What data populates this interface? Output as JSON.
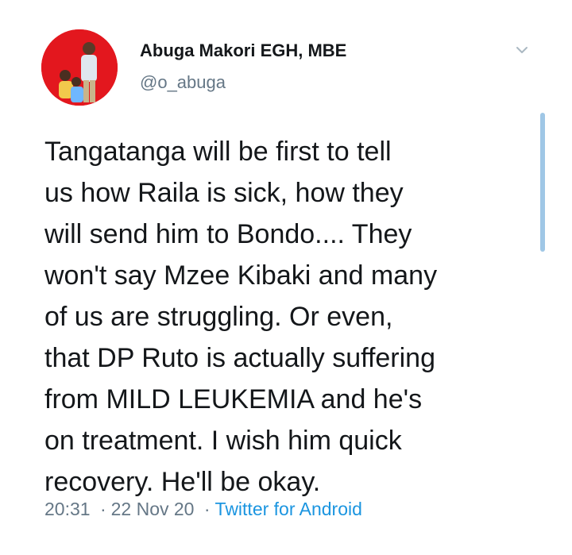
{
  "tweet": {
    "author": {
      "display_name": "Abuga Makori EGH, MBE",
      "handle": "@o_abuga"
    },
    "text": "Tangatanga will be first to tell\nus how Raila is sick, how they\nwill send him to Bondo.... They\nwon't say Mzee Kibaki and many\nof us are struggling. Or even,\nthat DP Ruto is actually suffering\nfrom MILD LEUKEMIA and he's\non treatment. I wish him quick\nrecovery. He'll be okay.",
    "time": "20:31",
    "separator": "·",
    "date": "22 Nov 20",
    "source": "Twitter for Android"
  },
  "icons": {
    "more": "chevron-down-icon",
    "avatar": "avatar"
  },
  "colors": {
    "text": "#14171a",
    "secondary": "#657786",
    "link": "#1b95e0",
    "avatar_bg": "#e3171e",
    "scrollbar": "#9fc7e6"
  }
}
